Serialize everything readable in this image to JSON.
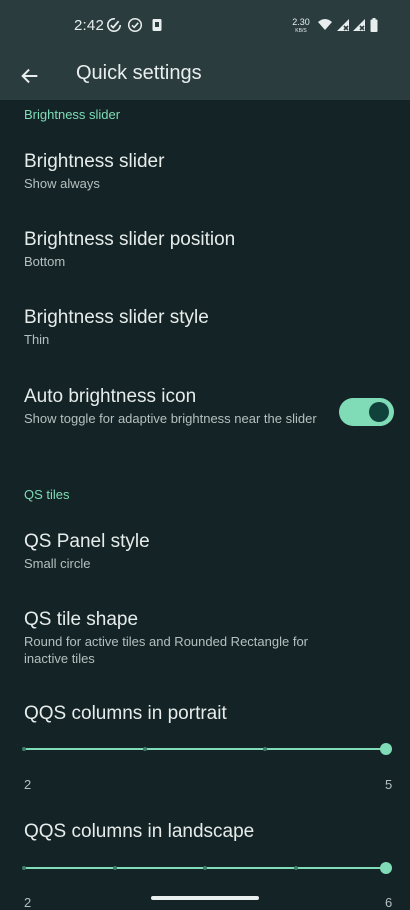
{
  "status_bar": {
    "time": "2:42",
    "speed_value": "2.30",
    "speed_unit": "KB/S",
    "icons": [
      "task-check-icon",
      "check-circle-icon",
      "sim-card-icon",
      "wifi-icon",
      "signal-x-icon",
      "signal-x-icon",
      "battery-icon"
    ]
  },
  "app_bar": {
    "back_icon": "back-arrow-icon",
    "title": "Quick settings"
  },
  "sections": {
    "brightness": {
      "header": "Brightness slider",
      "items": [
        {
          "title": "Brightness slider",
          "summary": "Show always"
        },
        {
          "title": "Brightness slider position",
          "summary": "Bottom"
        },
        {
          "title": "Brightness slider style",
          "summary": "Thin"
        },
        {
          "title": "Auto brightness icon",
          "summary": "Show toggle for adaptive brightness near the slider",
          "toggle_on": true
        }
      ]
    },
    "qs_tiles": {
      "header": "QS tiles",
      "items": [
        {
          "title": "QS Panel style",
          "summary": "Small circle"
        },
        {
          "title": "QS tile shape",
          "summary": "Round for active tiles and Rounded Rectangle for inactive tiles"
        }
      ],
      "sliders": [
        {
          "title": "QQS columns in portrait",
          "min_label": "2",
          "max_label": "5",
          "min": 2,
          "max": 5,
          "value": 5
        },
        {
          "title": "QQS columns in landscape",
          "min_label": "2",
          "max_label": "6",
          "min": 2,
          "max": 6,
          "value": 6
        }
      ]
    }
  },
  "colors": {
    "background": "#142326",
    "app_bar": "#2b3c3f",
    "accent": "#7fdcb6",
    "toggle_thumb": "#10413a"
  }
}
